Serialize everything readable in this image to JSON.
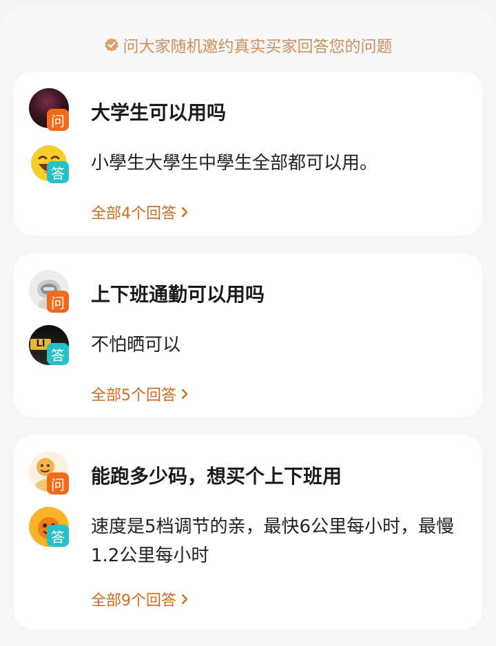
{
  "banner": {
    "icon": "verified-check-icon",
    "text": "问大家随机邀约真实买家回答您的问题"
  },
  "qa_items": [
    {
      "question_tag": "问",
      "question": "大学生可以用吗",
      "answer_tag": "答",
      "answer": "小學生大學生中學生全部都可以用。",
      "more_label": "全部4个回答"
    },
    {
      "question_tag": "问",
      "question": "上下班通勤可以用吗",
      "answer_tag": "答",
      "answer": "不怕晒可以",
      "answerer_avatar_text": "LI",
      "more_label": "全部5个回答"
    },
    {
      "question_tag": "问",
      "question": "能跑多少码，想买个上下班用",
      "answer_tag": "答",
      "answer": "速度是5档调节的亲，最快6公里每小时，最慢1.2公里每小时",
      "more_label": "全部9个回答"
    }
  ],
  "colors": {
    "accent": "#d2691e",
    "question_tag": "#f36a1d",
    "answer_tag": "#26c1c7",
    "banner_text": "#c9925f"
  }
}
